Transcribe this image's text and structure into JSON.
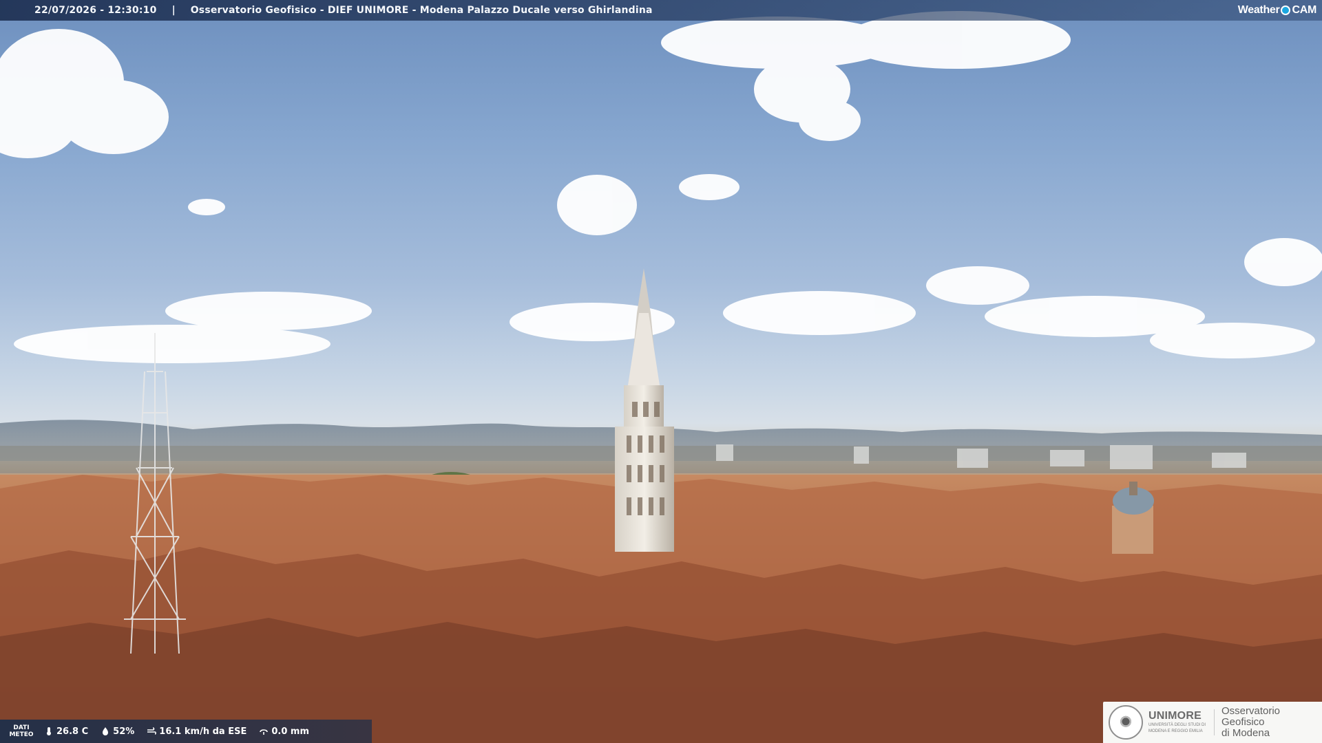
{
  "overlay": {
    "timestamp": "22/07/2026 - 12:30:10",
    "separator": "|",
    "title": "Osservatorio Geofisico - DIEF UNIMORE - Modena Palazzo Ducale verso Ghirlandina",
    "brand_prefix": "Weather",
    "brand_suffix": "CAM"
  },
  "weather_strip": {
    "dati_line_1": "DATI",
    "dati_line_2": "METEO",
    "temperature": "26.8 C",
    "humidity": "52%",
    "wind": "16.1 km/h da ESE",
    "rain": "0.0 mm"
  },
  "logo": {
    "uni": "UNIMORE",
    "sub_line_1": "UNIVERSITÀ DEGLI STUDI DI",
    "sub_line_2": "MODENA E REGGIO EMILIA",
    "osservatorio_line_1": "Osservatorio Geofisico",
    "osservatorio_line_2": "di Modena"
  },
  "icons": {
    "temperature": "thermometer-icon",
    "humidity": "droplet-icon",
    "wind": "wind-icon",
    "rain": "rain-icon",
    "brand": "camera-dot-icon",
    "seal": "university-seal-icon"
  },
  "colors": {
    "accent": "#df7a2c",
    "brand_dot": "#1ba7e0",
    "overlay": "#1e3052"
  }
}
